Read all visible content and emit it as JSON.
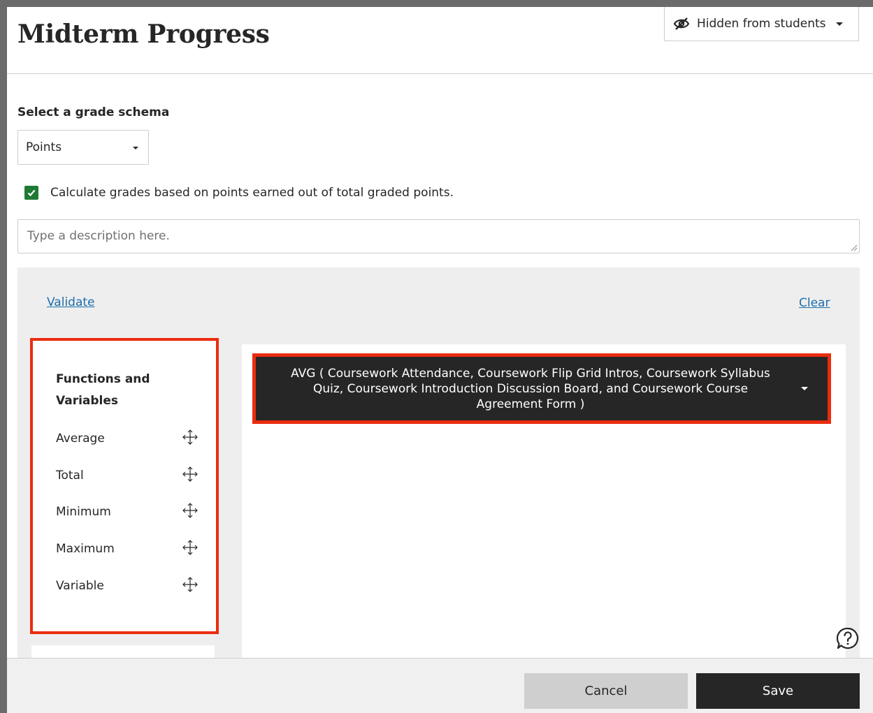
{
  "header": {
    "title": "Midterm Progress",
    "visibility_label": "Hidden from students"
  },
  "schema": {
    "label": "Select a grade schema",
    "selected": "Points"
  },
  "calc_option": {
    "label": "Calculate grades based on points earned out of total graded points.",
    "checked": true
  },
  "description": {
    "placeholder": "Type a description here.",
    "value": ""
  },
  "builder": {
    "validate_label": "Validate",
    "clear_label": "Clear",
    "functions_heading": "Functions and Variables",
    "functions": [
      {
        "label": "Average"
      },
      {
        "label": "Total"
      },
      {
        "label": "Minimum"
      },
      {
        "label": "Maximum"
      },
      {
        "label": "Variable"
      }
    ],
    "formula": "AVG ( Coursework Attendance, Coursework Flip Grid Intros, Coursework Syllabus Quiz, Coursework Introduction Discussion Board, and Coursework Course Agreement Form )"
  },
  "footer": {
    "cancel_label": "Cancel",
    "save_label": "Save"
  },
  "colors": {
    "highlight": "#ea2c10",
    "link": "#1c6ead",
    "checkbox": "#1f7a34",
    "dark": "#262626"
  },
  "icons": [
    "eye-slash-icon",
    "chevron-down-icon",
    "checkmark-icon",
    "move-icon",
    "help-icon"
  ]
}
